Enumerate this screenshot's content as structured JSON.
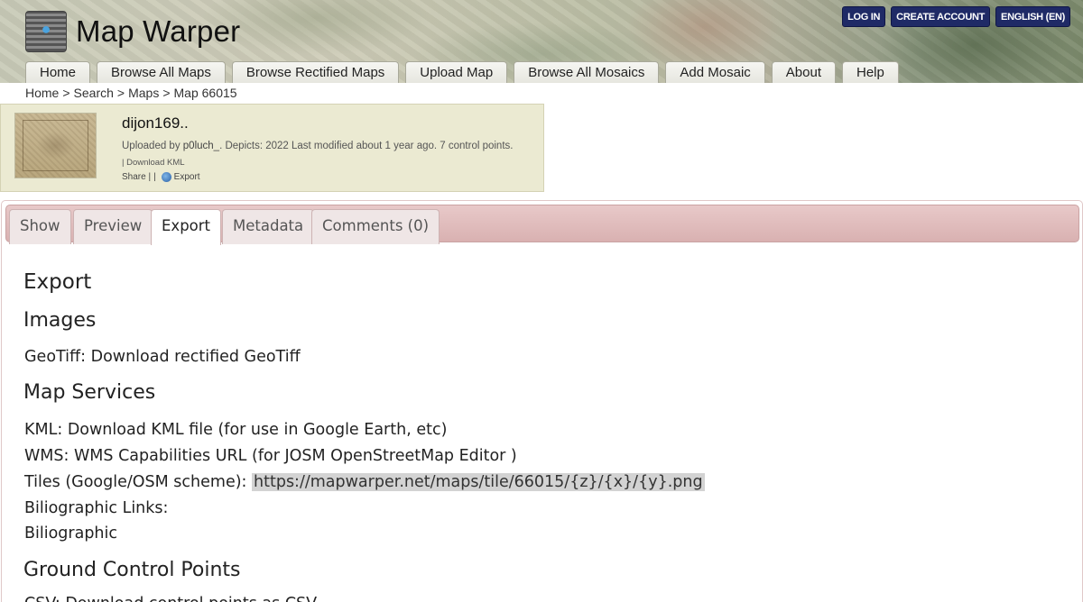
{
  "header": {
    "site_title": "Map Warper",
    "top_buttons": {
      "login": "LOG IN",
      "create_account": "CREATE ACCOUNT",
      "language": "ENGLISH (EN)"
    },
    "nav": [
      "Home",
      "Browse All Maps",
      "Browse Rectified Maps",
      "Upload Map",
      "Browse All Mosaics",
      "Add Mosaic",
      "About",
      "Help"
    ]
  },
  "breadcrumb": {
    "items": [
      "Home",
      "Search",
      "Maps",
      "Map 66015"
    ],
    "separator": ">"
  },
  "map_summary": {
    "title": "dijon169..",
    "uploaded_prefix": "Uploaded by",
    "uploader": "p0luch_",
    "meta_rest": ". Depicts: 2022 Last modified about 1 year ago. 7 control points.",
    "kml_link": "| Download KML",
    "share": "Share |",
    "pipe": "|",
    "export": "Export"
  },
  "tabs": {
    "items": [
      "Show",
      "Preview",
      "Export",
      "Metadata",
      "Comments (0)"
    ],
    "active": "Export"
  },
  "export_page": {
    "heading": "Export",
    "images_heading": "Images",
    "geotiff_label": "GeoTiff:",
    "geotiff_link": "Download rectified GeoTiff",
    "services_heading": "Map Services",
    "kml_label": "KML:",
    "kml_link": "Download KML file",
    "kml_note": "(for use in Google Earth, etc)",
    "wms_label": "WMS:",
    "wms_link": "WMS Capabilities URL",
    "wms_note": "(for JOSM OpenStreetMap Editor )",
    "tiles_label": "Tiles (Google/OSM scheme):",
    "tiles_url": "https://mapwarper.net/maps/tile/66015/{z}/{x}/{y}.png",
    "biblio_label": "Biliographic Links:",
    "biblio_link": "Biliographic",
    "gcp_heading": "Ground Control Points",
    "csv_line": "CSV: Download control points as CSV"
  },
  "colors": {
    "top_button_bg": "#1f2a66",
    "summary_bg": "#ebead2",
    "tabbar_bg": "#e8c9c9",
    "url_highlight": "#d3d3d3"
  },
  "icons": {
    "logo": "map-pin-icon",
    "export": "globe-icon"
  }
}
